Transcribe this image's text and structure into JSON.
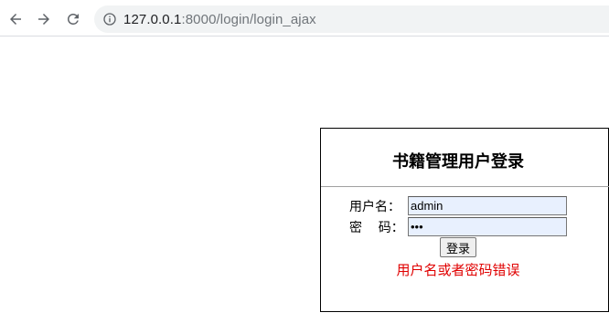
{
  "browser": {
    "url_host": "127.0.0.1",
    "url_rest": ":8000/login/login_ajax",
    "back_icon": "back-arrow-icon",
    "forward_icon": "forward-arrow-icon",
    "reload_icon": "reload-icon",
    "info_icon": "info-icon"
  },
  "login": {
    "title": "书籍管理用户登录",
    "username_label": "用户名：",
    "username_value": "admin",
    "password_label": "密    码：",
    "password_value": "•••",
    "submit_label": "登录",
    "error_message": "用户名或者密码错误"
  },
  "colors": {
    "error": "#e00000",
    "autofill_bg": "#e8f0fe",
    "omnibox_bg": "#f1f3f4"
  }
}
